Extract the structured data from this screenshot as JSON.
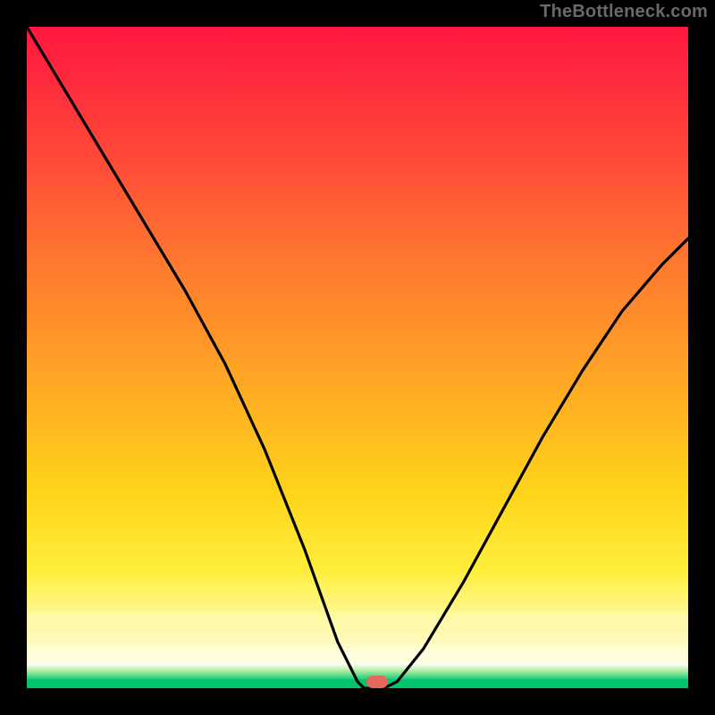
{
  "watermark": "TheBottleneck.com",
  "chart_data": {
    "type": "line",
    "title": "",
    "xlabel": "",
    "ylabel": "",
    "xlim": [
      0,
      100
    ],
    "ylim": [
      0,
      100
    ],
    "series": [
      {
        "name": "bottleneck-curve",
        "x": [
          0,
          6,
          12,
          18,
          24,
          30,
          36,
          42,
          47,
          50,
          51,
          54,
          56,
          60,
          66,
          72,
          78,
          84,
          90,
          96,
          100
        ],
        "y": [
          100,
          90,
          80,
          70,
          60,
          49,
          36,
          21,
          7,
          1,
          0,
          0,
          1,
          6,
          16,
          27,
          38,
          48,
          57,
          64,
          68
        ]
      }
    ],
    "marker": {
      "x": 53,
      "y": 1
    },
    "background_gradient": {
      "stops": [
        {
          "pos": 0,
          "color": "#ff173f"
        },
        {
          "pos": 20,
          "color": "#ff4a38"
        },
        {
          "pos": 52,
          "color": "#ffa326"
        },
        {
          "pos": 82,
          "color": "#ffee3a"
        },
        {
          "pos": 96,
          "color": "#fffde0"
        },
        {
          "pos": 99,
          "color": "#27d27d"
        },
        {
          "pos": 100,
          "color": "#03c36b"
        }
      ]
    }
  }
}
